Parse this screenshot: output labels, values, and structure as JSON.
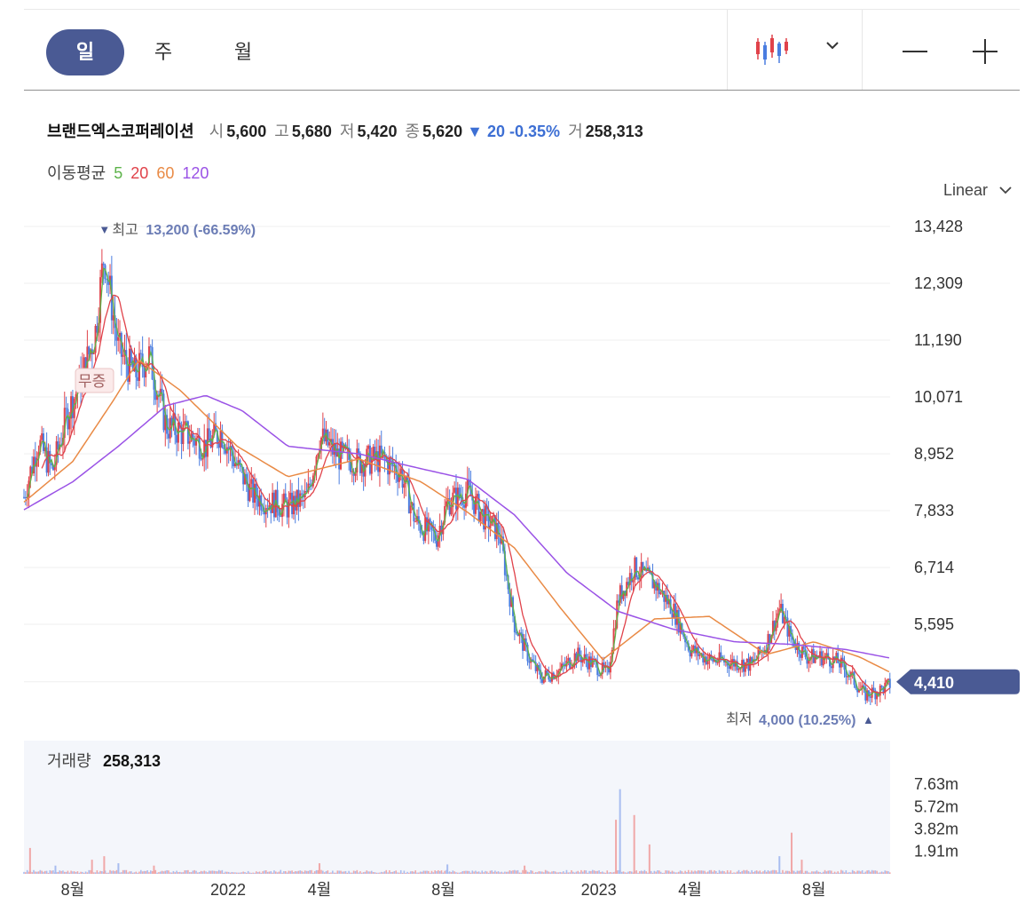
{
  "toolbar": {
    "periods": [
      "일",
      "주",
      "월"
    ],
    "active_period": "일",
    "chart_type_icon": "candlestick-icon",
    "zoom_out_icon": "minus-icon",
    "zoom_in_icon": "plus-icon"
  },
  "stock": {
    "name": "브랜드엑스코퍼레이션",
    "open_label": "시",
    "open": "5,600",
    "high_label": "고",
    "high": "5,680",
    "low_label": "저",
    "low": "5,420",
    "close_label": "종",
    "close": "5,620",
    "change_arrow": "▼",
    "change": "20",
    "change_pct": "-0.35%",
    "volume_label": "거",
    "volume": "258,313"
  },
  "moving_average": {
    "label": "이동평균",
    "periods": [
      "5",
      "20",
      "60",
      "120"
    ],
    "colors": [
      "#5db34a",
      "#e0424a",
      "#e98a45",
      "#9a52e6"
    ]
  },
  "scale": {
    "label": "Linear"
  },
  "colors": {
    "up": "#e0424a",
    "down": "#4a7de0",
    "accent": "#4a5a94"
  },
  "chart_data": {
    "type": "candlestick",
    "y_ticks": [
      "13,428",
      "12,309",
      "11,190",
      "10,071",
      "8,952",
      "7,833",
      "6,714",
      "5,595"
    ],
    "y_tick_values": [
      13428,
      12309,
      11190,
      10071,
      8952,
      7833,
      6714,
      5595
    ],
    "current_price_tag": "4,410",
    "current_price": 4410,
    "max_marker": {
      "arrow": "▼",
      "label": "최고",
      "value": "13,200",
      "pct": "(-66.59%)"
    },
    "min_marker": {
      "label": "최저",
      "value": "4,000",
      "pct": "(10.25%)",
      "arrow": "▲"
    },
    "event_label": "무증",
    "x_ticks": [
      "8월",
      "2022",
      "4월",
      "8월",
      "2023",
      "4월",
      "8월"
    ],
    "x_tick_dates": [
      "2021-08",
      "2022-01",
      "2022-04",
      "2022-08",
      "2023-01",
      "2023-04",
      "2023-08"
    ],
    "price_path": [
      [
        "2021-06-14",
        8100
      ],
      [
        "2021-06-28",
        9200
      ],
      [
        "2021-07-12",
        8600
      ],
      [
        "2021-07-26",
        9700
      ],
      [
        "2021-08-09",
        10400
      ],
      [
        "2021-08-23",
        11300
      ],
      [
        "2021-09-01",
        12900
      ],
      [
        "2021-09-15",
        11000
      ],
      [
        "2021-10-01",
        10500
      ],
      [
        "2021-10-15",
        10900
      ],
      [
        "2021-11-01",
        9500
      ],
      [
        "2021-11-20",
        9350
      ],
      [
        "2021-12-10",
        9100
      ],
      [
        "2021-12-25",
        9400
      ],
      [
        "2022-01-10",
        8700
      ],
      [
        "2022-01-25",
        8150
      ],
      [
        "2022-02-10",
        8000
      ],
      [
        "2022-03-01",
        7900
      ],
      [
        "2022-03-20",
        8100
      ],
      [
        "2022-04-01",
        9300
      ],
      [
        "2022-04-20",
        8900
      ],
      [
        "2022-05-10",
        8800
      ],
      [
        "2022-06-01",
        8850
      ],
      [
        "2022-06-20",
        8600
      ],
      [
        "2022-07-05",
        7600
      ],
      [
        "2022-07-25",
        7300
      ],
      [
        "2022-08-05",
        8000
      ],
      [
        "2022-08-25",
        8200
      ],
      [
        "2022-09-10",
        7700
      ],
      [
        "2022-09-25",
        7400
      ],
      [
        "2022-10-10",
        5600
      ],
      [
        "2022-10-25",
        4900
      ],
      [
        "2022-11-05",
        4550
      ],
      [
        "2022-11-25",
        4700
      ],
      [
        "2022-12-10",
        5000
      ],
      [
        "2022-12-28",
        4800
      ],
      [
        "2023-01-10",
        4600
      ],
      [
        "2023-01-20",
        6100
      ],
      [
        "2023-02-05",
        6700
      ],
      [
        "2023-02-25",
        6400
      ],
      [
        "2023-03-15",
        5900
      ],
      [
        "2023-04-01",
        5100
      ],
      [
        "2023-04-20",
        4900
      ],
      [
        "2023-05-10",
        4850
      ],
      [
        "2023-06-01",
        4800
      ],
      [
        "2023-06-15",
        5200
      ],
      [
        "2023-06-28",
        5900
      ],
      [
        "2023-07-10",
        5300
      ],
      [
        "2023-07-25",
        4950
      ],
      [
        "2023-08-10",
        4950
      ],
      [
        "2023-08-25",
        4850
      ],
      [
        "2023-09-05",
        4600
      ],
      [
        "2023-09-20",
        4200
      ],
      [
        "2023-10-05",
        4300
      ],
      [
        "2023-10-15",
        4410
      ]
    ],
    "ma120_path": [
      [
        "2021-06-14",
        7850
      ],
      [
        "2021-08-01",
        8400
      ],
      [
        "2021-09-15",
        9100
      ],
      [
        "2021-11-01",
        9900
      ],
      [
        "2021-12-10",
        10100
      ],
      [
        "2022-01-15",
        9800
      ],
      [
        "2022-03-01",
        9100
      ],
      [
        "2022-05-10",
        8950
      ],
      [
        "2022-07-01",
        8700
      ],
      [
        "2022-08-25",
        8450
      ],
      [
        "2022-10-10",
        7750
      ],
      [
        "2022-12-01",
        6600
      ],
      [
        "2023-01-20",
        5850
      ],
      [
        "2023-03-15",
        5500
      ],
      [
        "2023-05-15",
        5250
      ],
      [
        "2023-07-10",
        5200
      ],
      [
        "2023-09-01",
        5100
      ],
      [
        "2023-10-15",
        4930
      ]
    ],
    "ma60_path": [
      [
        "2021-06-14",
        8000
      ],
      [
        "2021-08-01",
        8800
      ],
      [
        "2021-09-10",
        10000
      ],
      [
        "2021-10-05",
        10800
      ],
      [
        "2021-11-15",
        10200
      ],
      [
        "2022-01-10",
        9100
      ],
      [
        "2022-03-01",
        8500
      ],
      [
        "2022-05-10",
        8850
      ],
      [
        "2022-07-10",
        8400
      ],
      [
        "2022-08-25",
        7800
      ],
      [
        "2022-10-10",
        7100
      ],
      [
        "2022-11-25",
        5900
      ],
      [
        "2023-01-05",
        4900
      ],
      [
        "2023-02-25",
        5700
      ],
      [
        "2023-04-20",
        5750
      ],
      [
        "2023-06-15",
        5000
      ],
      [
        "2023-08-01",
        5250
      ],
      [
        "2023-09-15",
        4950
      ],
      [
        "2023-10-15",
        4650
      ]
    ],
    "volume": {
      "label": "거래량",
      "value": "258,313",
      "y_ticks": [
        "7.63m",
        "5.72m",
        "3.82m",
        "1.91m"
      ],
      "y_tick_values": [
        7630000,
        5720000,
        3820000,
        1910000
      ],
      "spikes": [
        [
          "2021-06-20",
          2200000
        ],
        [
          "2021-07-15",
          700000
        ],
        [
          "2021-08-20",
          1200000
        ],
        [
          "2021-09-01",
          1500000
        ],
        [
          "2021-09-15",
          900000
        ],
        [
          "2021-10-20",
          700000
        ],
        [
          "2022-04-01",
          900000
        ],
        [
          "2022-08-05",
          800000
        ],
        [
          "2022-10-20",
          700000
        ],
        [
          "2023-01-18",
          4600000
        ],
        [
          "2023-01-22",
          7200000
        ],
        [
          "2023-02-05",
          5000000
        ],
        [
          "2023-02-20",
          2500000
        ],
        [
          "2023-06-28",
          1500000
        ],
        [
          "2023-07-10",
          3500000
        ],
        [
          "2023-07-20",
          1200000
        ]
      ]
    }
  }
}
